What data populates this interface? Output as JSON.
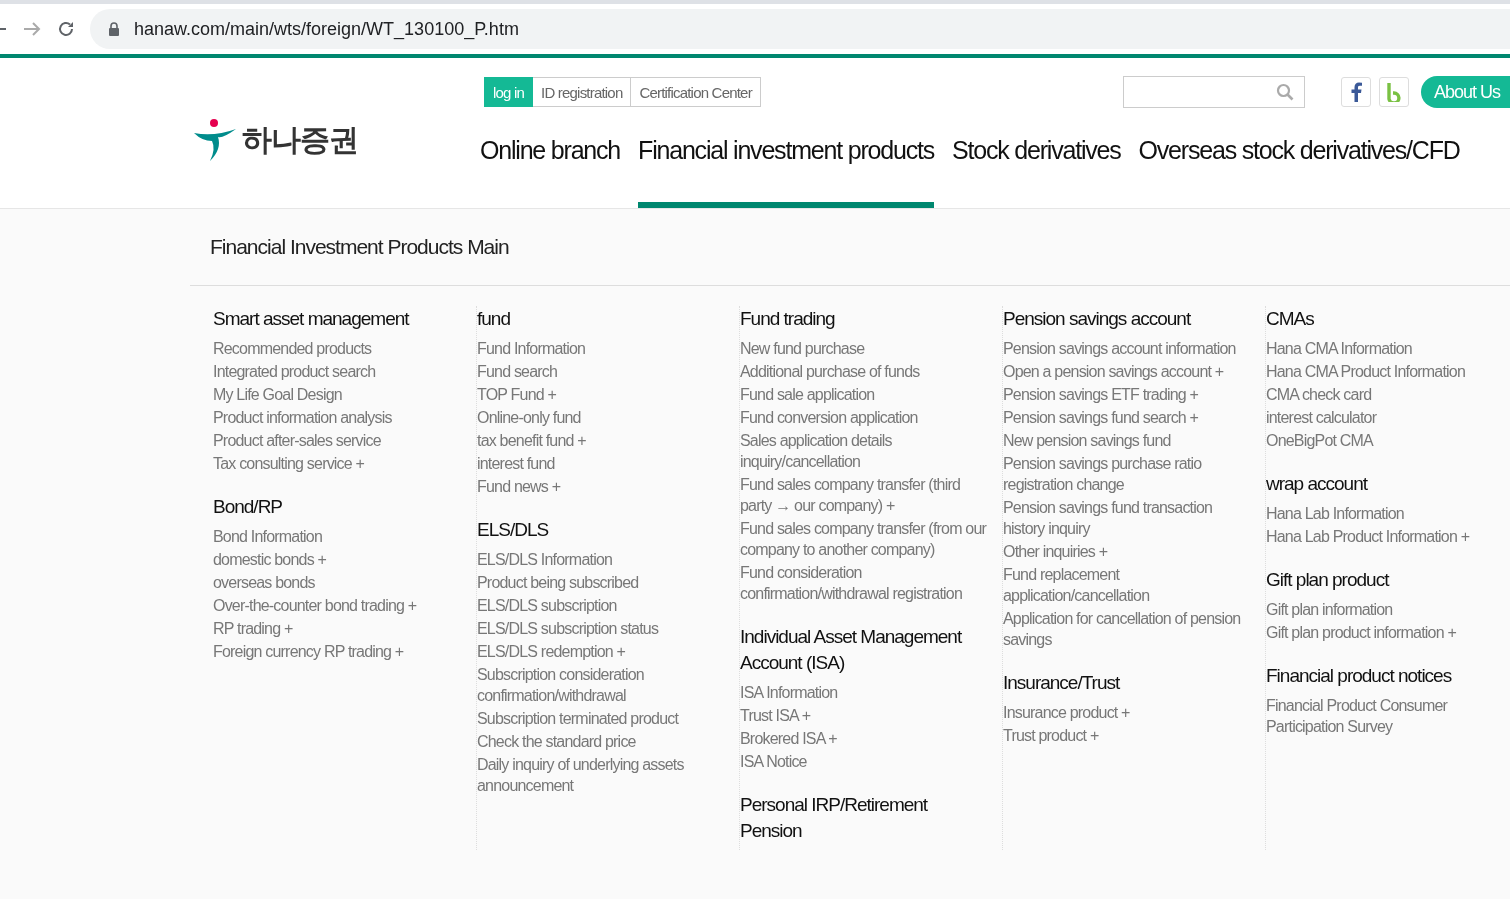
{
  "browser": {
    "url": "hanaw.com/main/wts/foreign/WT_130100_P.htm"
  },
  "top_links": [
    {
      "label": "log in",
      "selected": true
    },
    {
      "label": "ID registration",
      "selected": false
    },
    {
      "label": "Certification Center",
      "selected": false
    }
  ],
  "logo": {
    "text": "하나증권"
  },
  "about_button": "About Us",
  "nav": [
    {
      "label": "Online branch",
      "selected": false
    },
    {
      "label": "Financial investment products",
      "selected": true
    },
    {
      "label": "Stock derivatives",
      "selected": false
    },
    {
      "label": "Overseas stock derivatives/CFD",
      "selected": false
    }
  ],
  "page_title": "Financial Investment Products Main",
  "columns": [
    {
      "sections": [
        {
          "title": "Smart asset management",
          "items": [
            "Recommended products",
            "Integrated product search",
            "My Life Goal Design",
            "Product information analysis",
            "Product after-sales service",
            "Tax consulting service +"
          ]
        },
        {
          "title": "Bond/RP",
          "items": [
            "Bond Information",
            "domestic bonds +",
            "overseas bonds",
            "Over-the-counter bond trading +",
            "RP trading +",
            "Foreign currency RP trading +"
          ]
        }
      ]
    },
    {
      "sections": [
        {
          "title": "fund",
          "items": [
            "Fund Information",
            "Fund search",
            "TOP Fund +",
            "Online-only fund",
            "tax benefit fund +",
            "interest fund",
            "Fund news +"
          ]
        },
        {
          "title": "ELS/DLS",
          "items": [
            "ELS/DLS Information",
            "Product being subscribed",
            "ELS/DLS subscription",
            "ELS/DLS subscription status",
            "ELS/DLS redemption +",
            "Subscription consideration confirmation/withdrawal",
            "Subscription terminated product",
            "Check the standard price",
            "Daily inquiry of underlying assets announcement"
          ]
        }
      ]
    },
    {
      "sections": [
        {
          "title": "Fund trading",
          "items": [
            "New fund purchase",
            "Additional purchase of funds",
            "Fund sale application",
            "Fund conversion application",
            "Sales application details inquiry/cancellation",
            "Fund sales company transfer (third party → our company) +",
            "Fund sales company transfer (from our company to another company)",
            "Fund consideration confirmation/withdrawal registration"
          ]
        },
        {
          "title": "Individual Asset Management Account (ISA)",
          "items": [
            "ISA Information",
            "Trust ISA +",
            "Brokered ISA +",
            "ISA Notice"
          ]
        },
        {
          "title": "Personal IRP/Retirement Pension"
        }
      ]
    },
    {
      "sections": [
        {
          "title": "Pension savings account",
          "items": [
            "Pension savings account information",
            "Open a pension savings account +",
            "Pension savings ETF trading +",
            "Pension savings fund search +",
            "New pension savings fund",
            "Pension savings purchase ratio registration change",
            "Pension savings fund transaction history inquiry",
            "Other inquiries +",
            "Fund replacement application/cancellation",
            "Application for cancellation of pension savings"
          ]
        },
        {
          "title": "Insurance/Trust",
          "items": [
            "Insurance product +",
            "Trust product +"
          ]
        }
      ]
    },
    {
      "sections": [
        {
          "title": "CMAs",
          "items": [
            "Hana CMA Information",
            "Hana CMA Product Information",
            "CMA check card",
            "interest calculator",
            "OneBigPot CMA"
          ]
        },
        {
          "title": "wrap account",
          "items": [
            "Hana Lab Information",
            "Hana Lab Product Information +"
          ]
        },
        {
          "title": "Gift plan product",
          "items": [
            "Gift plan information",
            "Gift plan product information +"
          ]
        },
        {
          "title": "Financial product notices",
          "items": [
            "Financial Product Consumer Participation Survey"
          ]
        }
      ]
    }
  ]
}
